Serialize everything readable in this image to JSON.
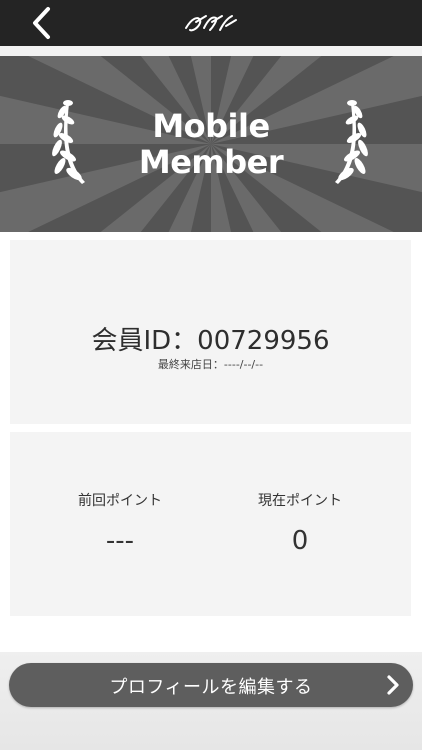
{
  "header": {
    "back_icon": "chevron-left-icon",
    "logo_icon": "brand-script-logo-icon"
  },
  "banner": {
    "title_line1": "Mobile",
    "title_line2": "Member",
    "left_icon": "laurel-branch-icon",
    "right_icon": "laurel-branch-icon"
  },
  "member": {
    "id_text": "会員ID：00729956",
    "last_visit_text": "最終来店日：----/--/--"
  },
  "points": {
    "previous_label": "前回ポイント",
    "previous_value": "---",
    "current_label": "現在ポイント",
    "current_value": "0"
  },
  "footer": {
    "edit_profile_label": "プロフィールを編集する",
    "edit_icon": "chevron-right-icon"
  },
  "colors": {
    "topbar": "#242424",
    "banner": "#545454",
    "button": "#5e5e5e",
    "card": "#f4f4f4"
  }
}
